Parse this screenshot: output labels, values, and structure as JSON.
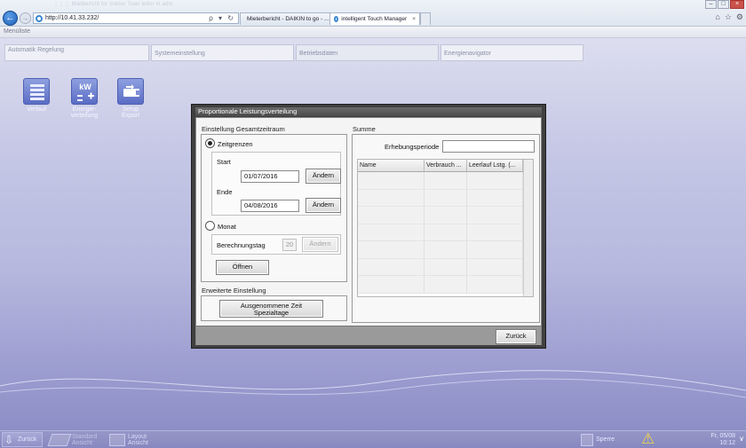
{
  "browser": {
    "title_faded": "⋮⋮⋮ Mietbericht for Indoor Tuan leiter m adm",
    "url": "http://10.41.33.232/",
    "address_tools": "ρ ▾ ↻",
    "tabs": [
      {
        "label": "Mieterbericht - DAIKIN to go - ...",
        "active": false
      },
      {
        "label": "intelligent Touch Manager",
        "active": true
      }
    ],
    "tab_close": "×",
    "window_buttons": {
      "minimize": "–",
      "maximize": "□",
      "close": "×"
    },
    "right_tools": [
      "⌂",
      "☆",
      "⚙"
    ]
  },
  "app": {
    "menu_label": "Menüliste",
    "tabs": [
      {
        "label": "Automatik Regelung"
      },
      {
        "label": "Systemeinstellung"
      },
      {
        "label": "Betriebsdaten"
      },
      {
        "label": "Energienavigator"
      }
    ],
    "icons": [
      {
        "label": "Verlauf",
        "icon": "history-chart-icon"
      },
      {
        "label": "Energie-verteilung",
        "icon": "energy-kw-icon"
      },
      {
        "label": "Setup Export",
        "icon": "usb-export-icon"
      }
    ]
  },
  "dialog": {
    "title": "Proportionale Leistungsverteilung",
    "period_section_label": "Einstellung Gesamtzeitraum",
    "radio_zeitgrenzen": {
      "label": "Zeitgrenzen",
      "checked": true
    },
    "start_label": "Start",
    "start_value": "01/07/2016",
    "end_label": "Ende",
    "end_value": "04/08/2016",
    "change_button": "Ändern",
    "radio_monat": {
      "label": "Monat",
      "checked": false
    },
    "berechnungstag_label": "Berechnungstag",
    "berechnungstag_value": "20",
    "open_button": "Öffnen",
    "advanced_section_label": "Erweiterte Einstellung",
    "excluded_button_line1": "Ausgenommene Zeit",
    "excluded_button_line2": "Spezialtage",
    "summary_label": "Summe",
    "erhebungsperiode_label": "Erhebungsperiode",
    "erhebungsperiode_value": "",
    "table": {
      "columns": [
        "Name",
        "Verbrauch ...",
        "Leerlauf Lstg. (..."
      ],
      "rows": [
        [
          "",
          "",
          ""
        ],
        [
          "",
          "",
          ""
        ],
        [
          "",
          "",
          ""
        ],
        [
          "",
          "",
          ""
        ],
        [
          "",
          "",
          ""
        ],
        [
          "",
          "",
          ""
        ],
        [
          "",
          "",
          ""
        ]
      ]
    },
    "back_button": "Zurück"
  },
  "bottombar": {
    "back_label": "Zurück",
    "back_icon": "⇩",
    "standard_line1": "Standard",
    "standard_line2": "Ansicht",
    "layout_line1": "Layout",
    "layout_line2": "Ansicht",
    "lock_label": "Sperre",
    "warning_icon": "⚠",
    "clock_line1": "Fr, 05/08",
    "clock_line2": "10:12",
    "chevron": "∨"
  },
  "colors": {
    "background_top": "#dfe0f0",
    "background_bottom": "#8c8ec6",
    "dialog_frame": "#404040",
    "bottombar": "#8c8dc4"
  }
}
